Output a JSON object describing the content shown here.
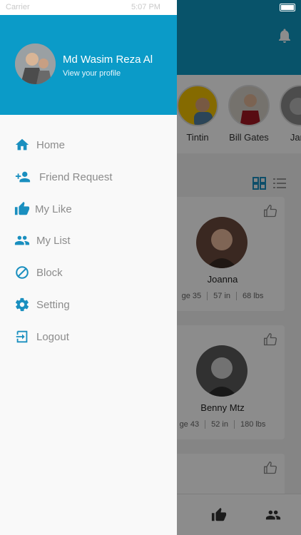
{
  "status_bar": {
    "carrier": "Carrier",
    "time": "5:07 PM"
  },
  "drawer": {
    "profile": {
      "name": "Md Wasim Reza Al",
      "subtitle": "View your profile"
    },
    "menu": [
      {
        "label": "Home",
        "icon": "home-icon"
      },
      {
        "label": "Friend Request",
        "icon": "person-add-icon"
      },
      {
        "label": "My Like",
        "icon": "thumb-up-icon"
      },
      {
        "label": "My List",
        "icon": "people-icon"
      },
      {
        "label": "Block",
        "icon": "block-icon"
      },
      {
        "label": "Setting",
        "icon": "gear-icon"
      },
      {
        "label": "Logout",
        "icon": "logout-icon"
      }
    ]
  },
  "background": {
    "stories": [
      {
        "name": "Tintin"
      },
      {
        "name": "Bill Gates"
      },
      {
        "name": "Jarin"
      }
    ],
    "cards": [
      {
        "name": "Joanna",
        "age": "ge 35",
        "height": "57 in",
        "weight": "68 lbs"
      },
      {
        "name": "Benny Mtz",
        "age": "ge 43",
        "height": "52 in",
        "weight": "180 lbs"
      }
    ]
  },
  "colors": {
    "accent": "#0b9bc8",
    "menu_icon": "#1a8fbf",
    "menu_text": "#8c8c8c"
  }
}
